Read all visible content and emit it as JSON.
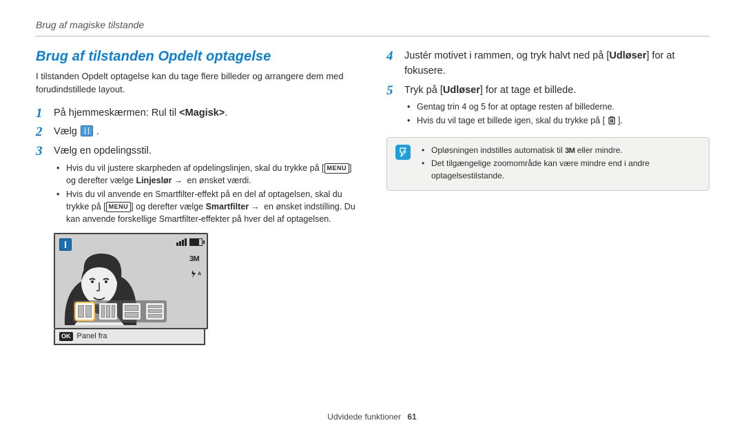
{
  "header": {
    "section": "Brug af magiske tilstande"
  },
  "left": {
    "heading": "Brug af tilstanden Opdelt optagelse",
    "intro": "I tilstanden Opdelt optagelse kan du tage flere billeder og arrangere dem med forudindstillede layout.",
    "steps": {
      "s1_pre": "På hjemmeskærmen: Rul til ",
      "s1_bold": "<Magisk>",
      "s1_post": ".",
      "s2_pre": "Vælg ",
      "s2_post": ".",
      "s3": "Vælg en opdelingsstil.",
      "s3_b1_pre": "Hvis du vil justere skarpheden af opdelingslinjen, skal du trykke på [",
      "s3_b1_menu": "MENU",
      "s3_b1_mid": "] og derefter vælge ",
      "s3_b1_bold": "Linjeslør",
      "s3_b1_arrow": "→",
      "s3_b1_post": " en ønsket værdi.",
      "s3_b2_pre": "Hvis du vil anvende en Smartfilter-effekt på en del af optagelsen, skal du trykke på [",
      "s3_b2_menu": "MENU",
      "s3_b2_mid": "] og derefter vælge ",
      "s3_b2_bold": "Smartfilter",
      "s3_b2_arrow": "→",
      "s3_b2_post": " en ønsket indstilling. Du kan anvende forskellige Smartfilter-effekter på hver del af optagelsen."
    },
    "camera": {
      "ok": "OK",
      "caption": "Panel fra",
      "size": "3M",
      "flash": "A"
    }
  },
  "right": {
    "steps": {
      "s4_pre": "Justér motivet i rammen, og tryk halvt ned på [",
      "s4_bold": "Udløser",
      "s4_post": "] for at fokusere.",
      "s5_pre": "Tryk på [",
      "s5_bold": "Udløser",
      "s5_post": "] for at tage et billede.",
      "s5_b1": "Gentag trin 4 og 5 for at optage resten af billederne.",
      "s5_b2_pre": "Hvis du vil tage et billede igen, skal du trykke på [ ",
      "s5_b2_post": " ]."
    },
    "info": {
      "b1_pre": "Opløsningen indstilles automatisk til ",
      "b1_size": "3M",
      "b1_post": " eller mindre.",
      "b2": "Det tilgængelige zoomområde kan være mindre end i andre optagelsestilstande."
    }
  },
  "footer": {
    "label": "Udvidede funktioner",
    "page": "61"
  }
}
